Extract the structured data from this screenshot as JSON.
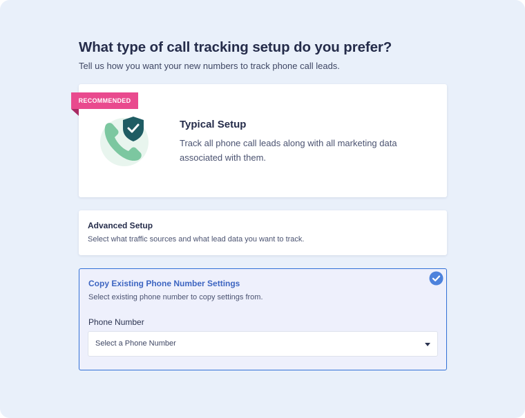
{
  "header": {
    "title": "What type of call tracking setup do you prefer?",
    "subtitle": "Tell us how you want your new numbers to track phone call leads."
  },
  "options": {
    "typical": {
      "badge": "RECOMMENDED",
      "title": "Typical Setup",
      "description": "Track all phone call leads along with all marketing data associated with them.",
      "icon": "phone-shield-icon"
    },
    "advanced": {
      "title": "Advanced Setup",
      "description": "Select what traffic sources and what lead data you want to track."
    },
    "copy": {
      "title": "Copy Existing Phone Number Settings",
      "description": "Select existing phone number to copy settings from.",
      "selected": true,
      "field_label": "Phone Number",
      "select_value": "Select a Phone Number"
    }
  },
  "colors": {
    "background": "#e9f0fa",
    "accent": "#2f6fd6",
    "badge": "#e94a8e",
    "icon_green": "#7cc7a0",
    "icon_dark": "#1f5c63"
  }
}
